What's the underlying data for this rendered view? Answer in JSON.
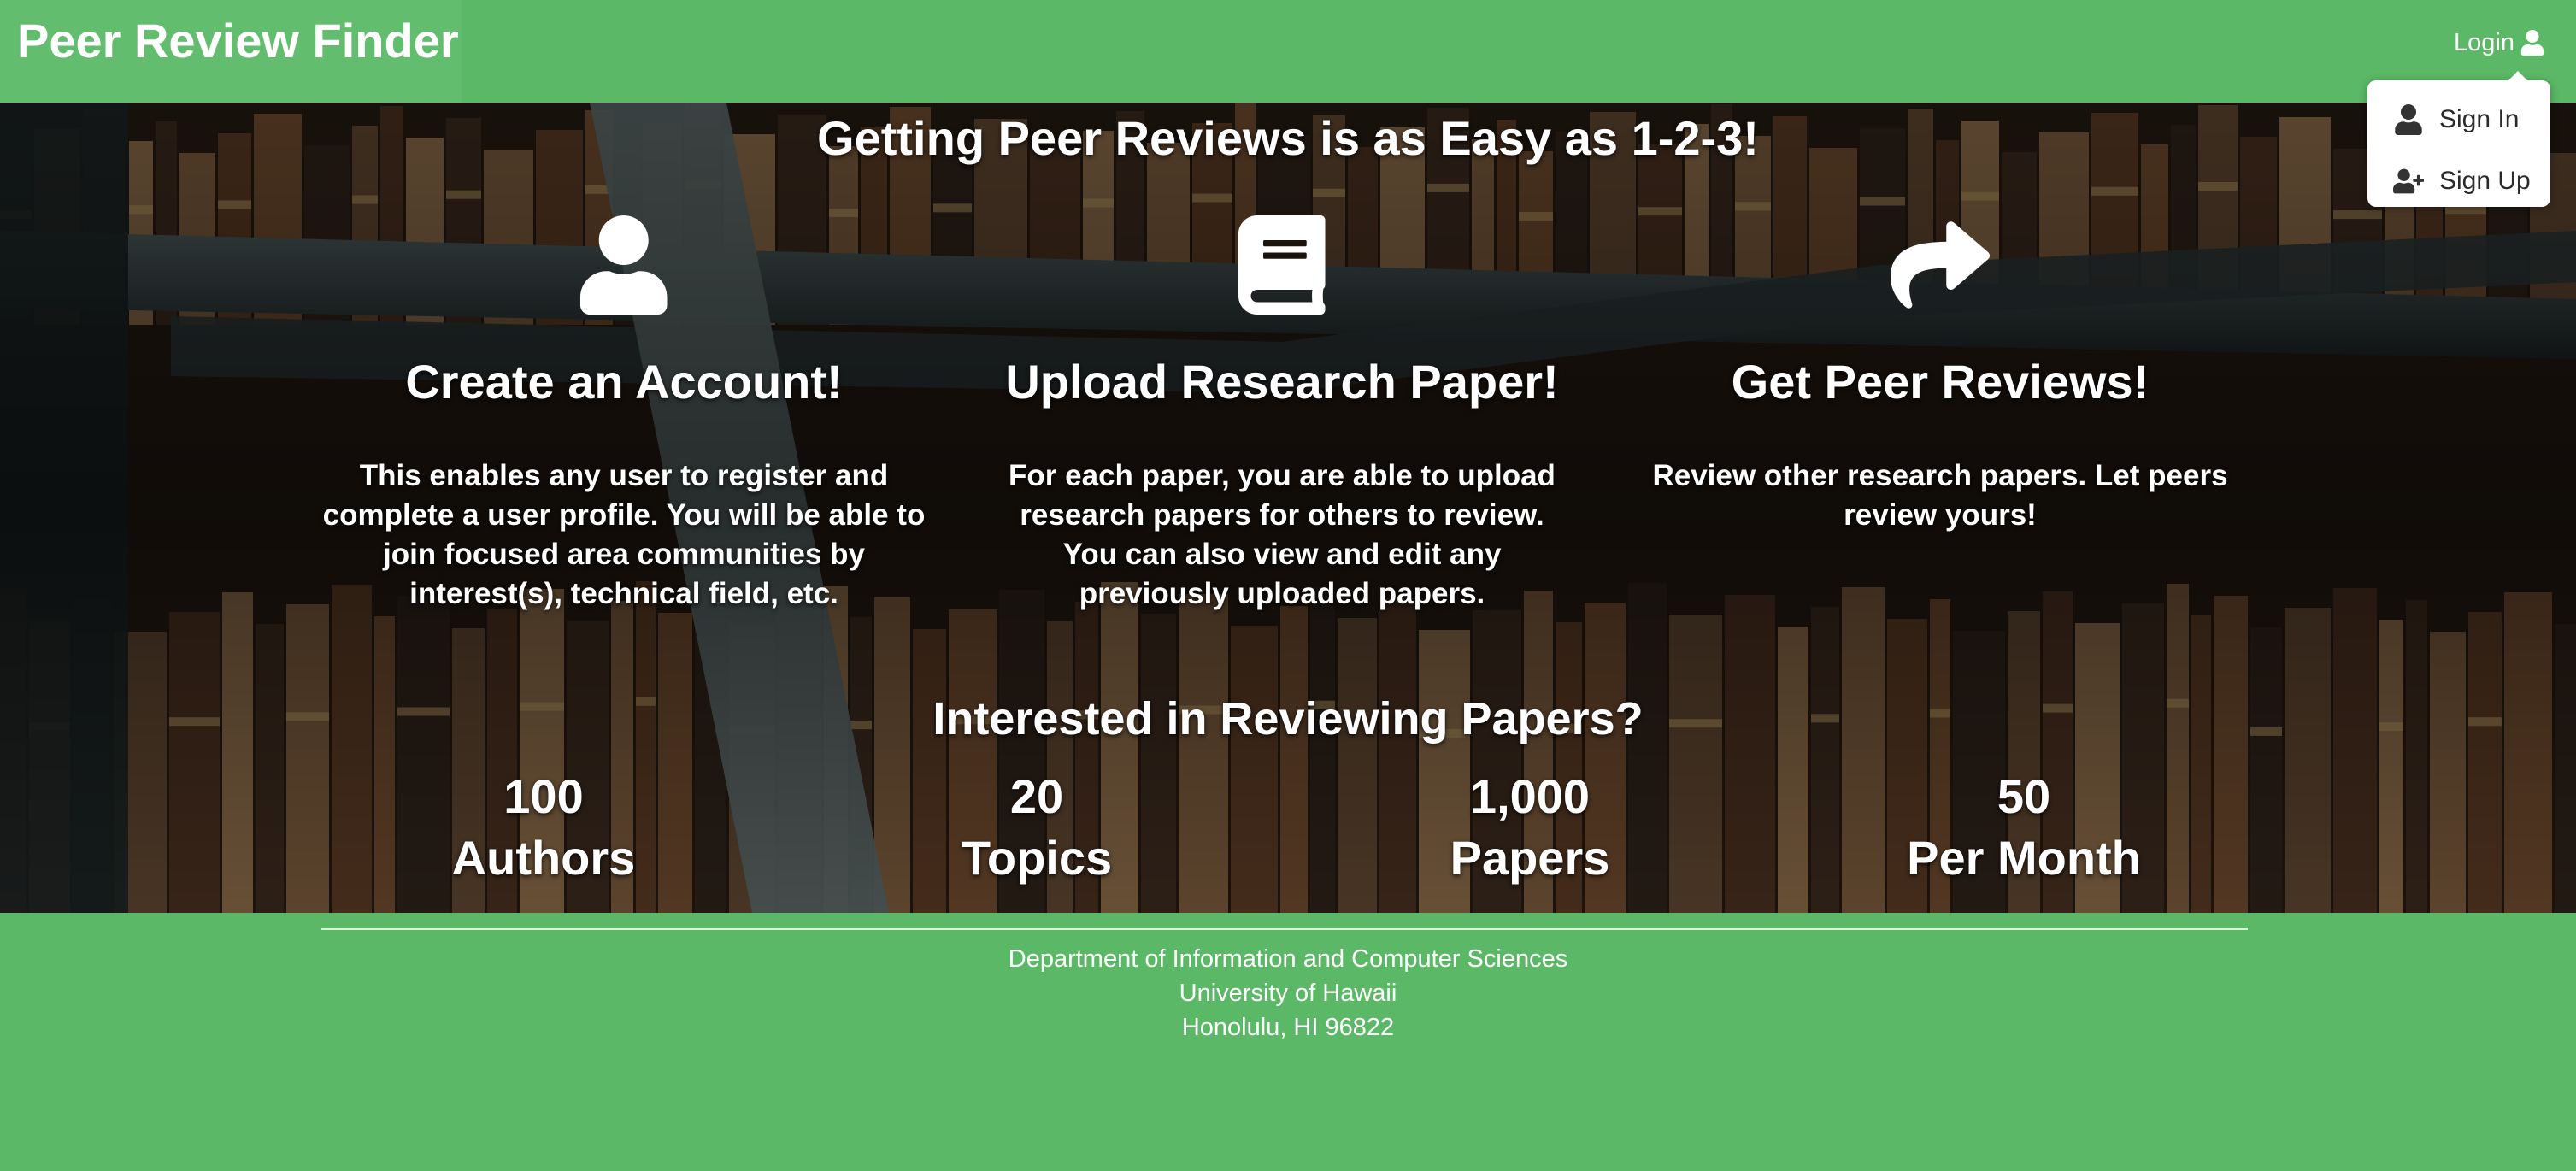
{
  "navbar": {
    "brand": "Peer Review Finder",
    "login_label": "Login",
    "login_icon": "user-icon",
    "bg_color": "#5bb866"
  },
  "dropdown": {
    "items": [
      {
        "label": "Sign In",
        "icon": "user-icon"
      },
      {
        "label": "Sign Up",
        "icon": "user-plus-icon"
      }
    ]
  },
  "hero": {
    "title": "Getting Peer Reviews is as Easy as 1-2-3!",
    "steps": [
      {
        "icon": "user-icon",
        "heading": "Create an Account!",
        "body": "This enables any user to register and complete a user profile. You will be able to join focused area communities by interest(s), technical field, etc."
      },
      {
        "icon": "book-icon",
        "heading": "Upload Research Paper!",
        "body": "For each paper, you are able to upload research papers for others to review. You can also view and edit any previously uploaded papers."
      },
      {
        "icon": "share-arrow-icon",
        "heading": "Get Peer Reviews!",
        "body": "Review other research papers. Let peers review yours!"
      }
    ],
    "interest_title": "Interested in Reviewing Papers?",
    "stats": [
      {
        "value": "100",
        "label": "Authors"
      },
      {
        "value": "20",
        "label": "Topics"
      },
      {
        "value": "1,000",
        "label": "Papers"
      },
      {
        "value": "50",
        "label": "Per Month"
      }
    ]
  },
  "footer": {
    "lines": [
      "Department of Information and Computer Sciences",
      "University of Hawaii",
      "Honolulu, HI 96822"
    ]
  }
}
